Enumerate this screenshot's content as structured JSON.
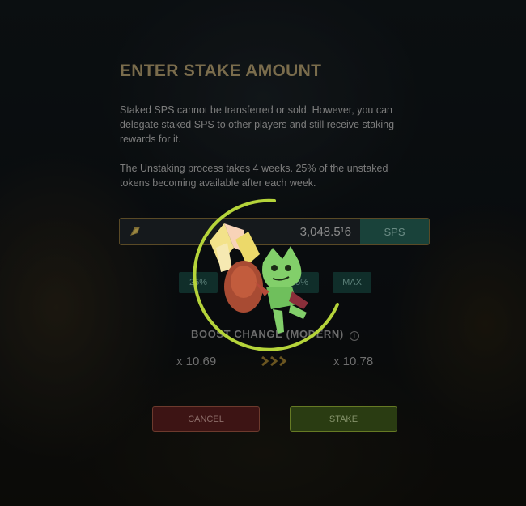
{
  "modal": {
    "title": "ENTER STAKE AMOUNT",
    "description_1": "Staked SPS cannot be transferred or sold. However, you can delegate staked SPS to other players and still receive staking rewards for it.",
    "description_2": "The Unstaking process takes 4 weeks. 25% of the unstaked tokens becoming available after each week."
  },
  "amount_input": {
    "value": "3,048.5¹6",
    "currency": "SPS",
    "icon": "sps-token-icon"
  },
  "percent_buttons": {
    "p25": "25%",
    "p75": "75%",
    "max": "MAX"
  },
  "boost": {
    "title": "BOOST CHANGE (MODERN)",
    "from": "x 10.69",
    "to": "x 10.78",
    "info_icon": "info-icon",
    "arrow_icon": "triple-chevron-right-icon"
  },
  "actions": {
    "cancel": "CANCEL",
    "stake": "STAKE"
  },
  "loading": {
    "icon": "goblin-carrying-crystals-loader",
    "accent_color": "#b5d43a"
  },
  "colors": {
    "title": "#7a6c4c",
    "currency_bg": "#19423a",
    "cancel_bg": "#3d1414",
    "stake_bg": "#2a3c12"
  }
}
